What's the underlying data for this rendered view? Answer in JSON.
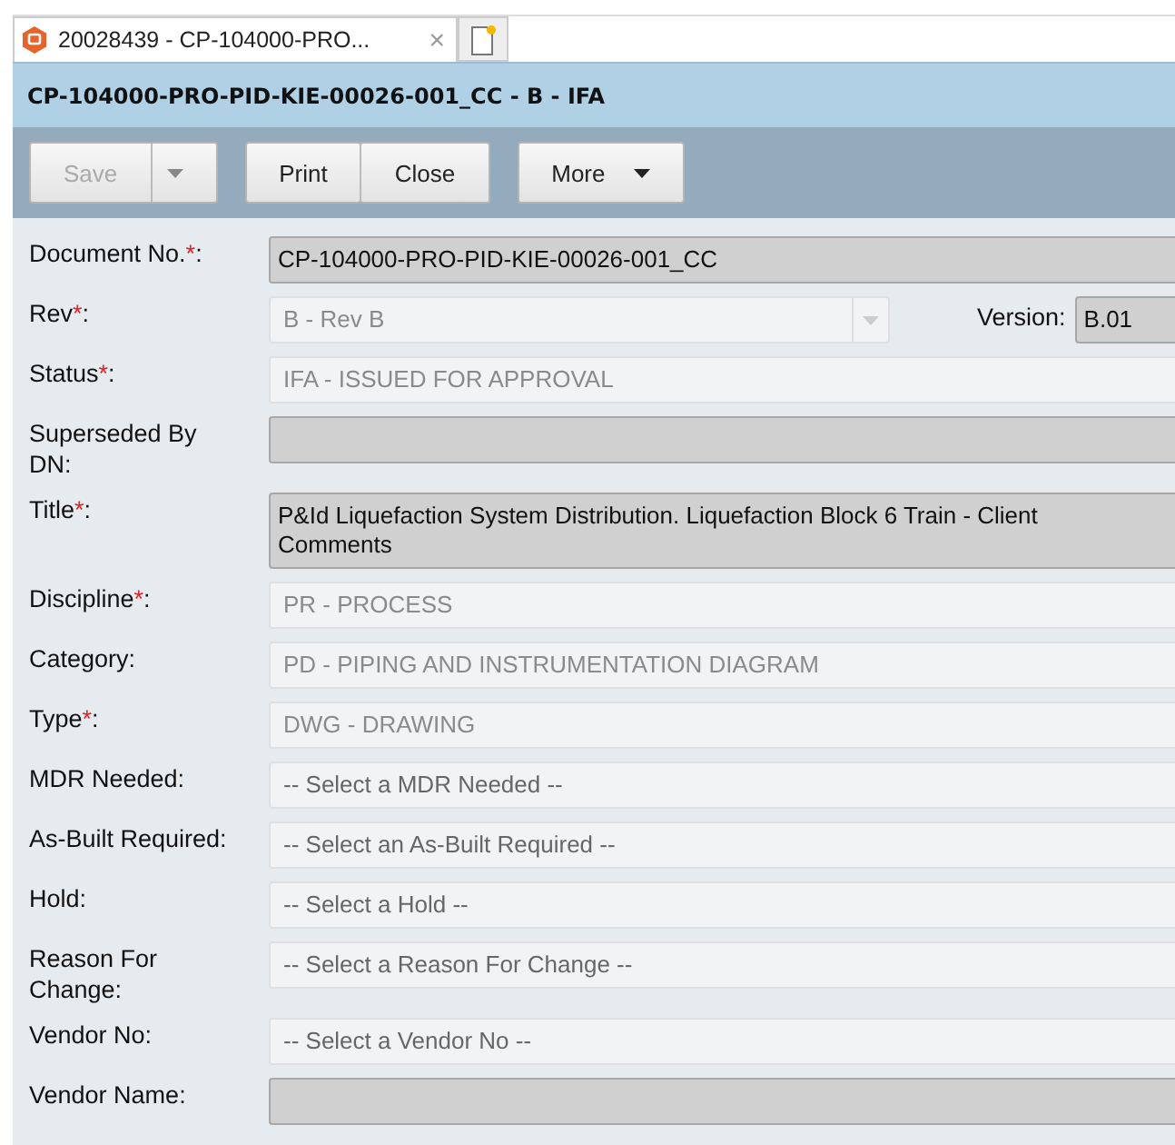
{
  "tab": {
    "title": "20028439 - CP-104000-PRO...",
    "close": "×"
  },
  "header": {
    "title": "CP-104000-PRO-PID-KIE-00026-001_CC - B - IFA"
  },
  "toolbar": [
    [
      {
        "label": "Save",
        "kind": "split",
        "disabled": true
      }
    ],
    [
      {
        "label": "Print",
        "kind": "plain",
        "disabled": false
      },
      {
        "label": "Close",
        "kind": "plain",
        "disabled": false
      }
    ],
    [
      {
        "label": "More",
        "kind": "menu",
        "disabled": false
      }
    ]
  ],
  "fields": [
    {
      "label": "Document No.",
      "asterisk": "*",
      "colon": ":",
      "kind": "readonly",
      "value": "CP-104000-PRO-PID-KIE-00026-001_CC"
    },
    {
      "label": "Rev",
      "asterisk": "*",
      "colon": ":",
      "kind": "combo",
      "disabled": true,
      "value": "B - Rev B",
      "version_label": "Version:",
      "version": "B.01"
    },
    {
      "label": "Status",
      "asterisk": "*",
      "colon": ":",
      "kind": "select",
      "disabled": true,
      "value": "IFA - ISSUED FOR APPROVAL"
    },
    {
      "label": "Superseded By\nDN",
      "colon": ":",
      "kind": "readonly"
    },
    {
      "label": "Title",
      "asterisk": "*",
      "colon": ":",
      "kind": "readonly",
      "value": "P&Id Liquefaction System Distribution. Liquefaction Block 6 Train - Client\nComments"
    },
    {
      "label": "Discipline",
      "asterisk": "*",
      "colon": ":",
      "kind": "select",
      "disabled": true,
      "value": "PR - PROCESS"
    },
    {
      "label": "Category",
      "colon": ":",
      "kind": "select",
      "disabled": true,
      "value": "PD - PIPING AND INSTRUMENTATION DIAGRAM"
    },
    {
      "label": "Type",
      "asterisk": "*",
      "colon": ":",
      "kind": "select",
      "disabled": true,
      "value": "DWG - DRAWING"
    },
    {
      "label": "MDR Needed",
      "colon": ":",
      "kind": "select",
      "disabled": false,
      "placeholder": "-- Select a MDR Needed --"
    },
    {
      "label": "As-Built Required",
      "colon": ":",
      "kind": "select",
      "disabled": false,
      "placeholder": "-- Select an As-Built Required --"
    },
    {
      "label": "Hold",
      "colon": ":",
      "kind": "select",
      "disabled": false,
      "placeholder": "-- Select a Hold --"
    },
    {
      "label": "Reason For\nChange",
      "colon": ":",
      "kind": "select",
      "disabled": false,
      "placeholder": "-- Select a Reason For Change --"
    },
    {
      "label": "Vendor No",
      "colon": ":",
      "kind": "select",
      "disabled": false,
      "placeholder": "-- Select a Vendor No --"
    },
    {
      "label": "Vendor Name",
      "colon": ":",
      "kind": "readonly"
    }
  ]
}
